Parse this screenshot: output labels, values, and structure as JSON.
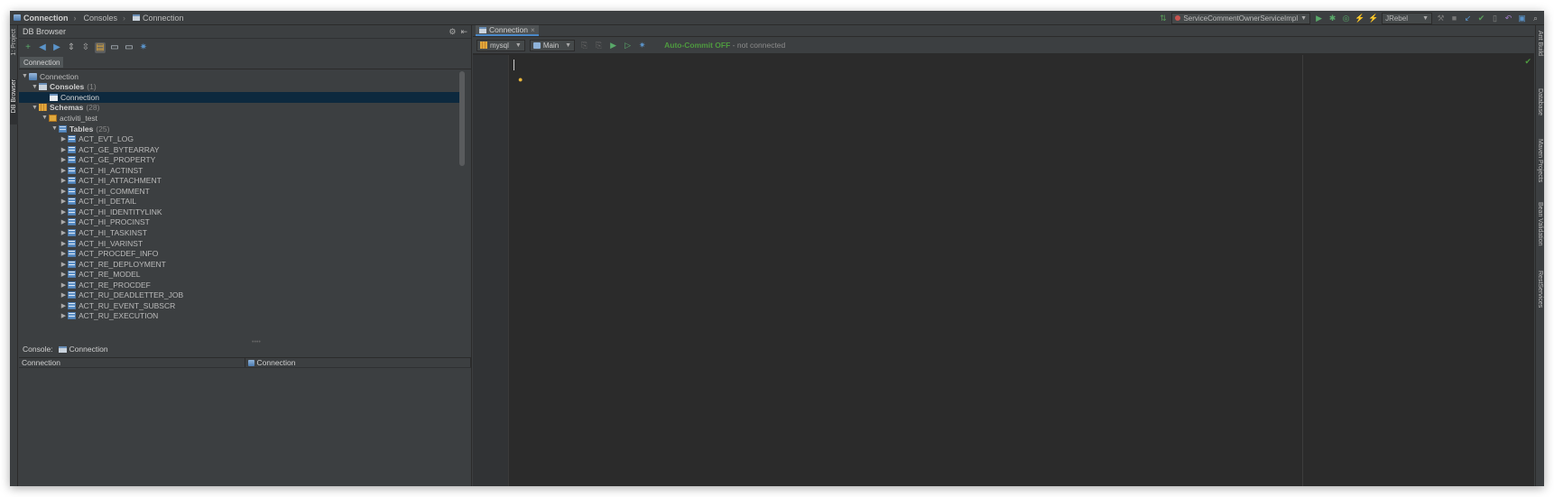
{
  "navbar": {
    "crumbs": [
      "Connection",
      "Consoles",
      "Connection"
    ],
    "run_config": "ServiceCommentOwnerServiceImpl",
    "jrebel": "JRebel"
  },
  "left_strip": {
    "tabs": [
      "1: Project",
      "DB Browser"
    ]
  },
  "right_strip": {
    "tabs": [
      "Ant Build",
      "Database",
      "Maven Projects",
      "Bean Validation",
      "RestServices"
    ]
  },
  "db_browser": {
    "title": "DB Browser",
    "connection_tab": "Connection",
    "tree": {
      "root": "Connection",
      "consoles": {
        "label": "Consoles",
        "count": "(1)"
      },
      "console_item": "Connection",
      "schemas": {
        "label": "Schemas",
        "count": "(28)"
      },
      "schema": "activiti_test",
      "tables": {
        "label": "Tables",
        "count": "(25)"
      },
      "table_items": [
        "ACT_EVT_LOG",
        "ACT_GE_BYTEARRAY",
        "ACT_GE_PROPERTY",
        "ACT_HI_ACTINST",
        "ACT_HI_ATTACHMENT",
        "ACT_HI_COMMENT",
        "ACT_HI_DETAIL",
        "ACT_HI_IDENTITYLINK",
        "ACT_HI_PROCINST",
        "ACT_HI_TASKINST",
        "ACT_HI_VARINST",
        "ACT_PROCDEF_INFO",
        "ACT_RE_DEPLOYMENT",
        "ACT_RE_MODEL",
        "ACT_RE_PROCDEF",
        "ACT_RU_DEADLETTER_JOB",
        "ACT_RU_EVENT_SUBSCR",
        "ACT_RU_EXECUTION"
      ]
    },
    "console": {
      "label": "Console:",
      "value": "Connection"
    },
    "properties": {
      "col1": "Connection",
      "col2": "Connection"
    }
  },
  "editor": {
    "tab": "Connection",
    "db_select": "mysql",
    "schema_select": "Main",
    "auto_commit": "Auto-Commit OFF",
    "status": " - not connected"
  },
  "colors": {
    "background": "#2b2b2b",
    "panel": "#3c3f41",
    "selection": "#0d293e",
    "auto_commit_green": "#4e9a3f"
  }
}
